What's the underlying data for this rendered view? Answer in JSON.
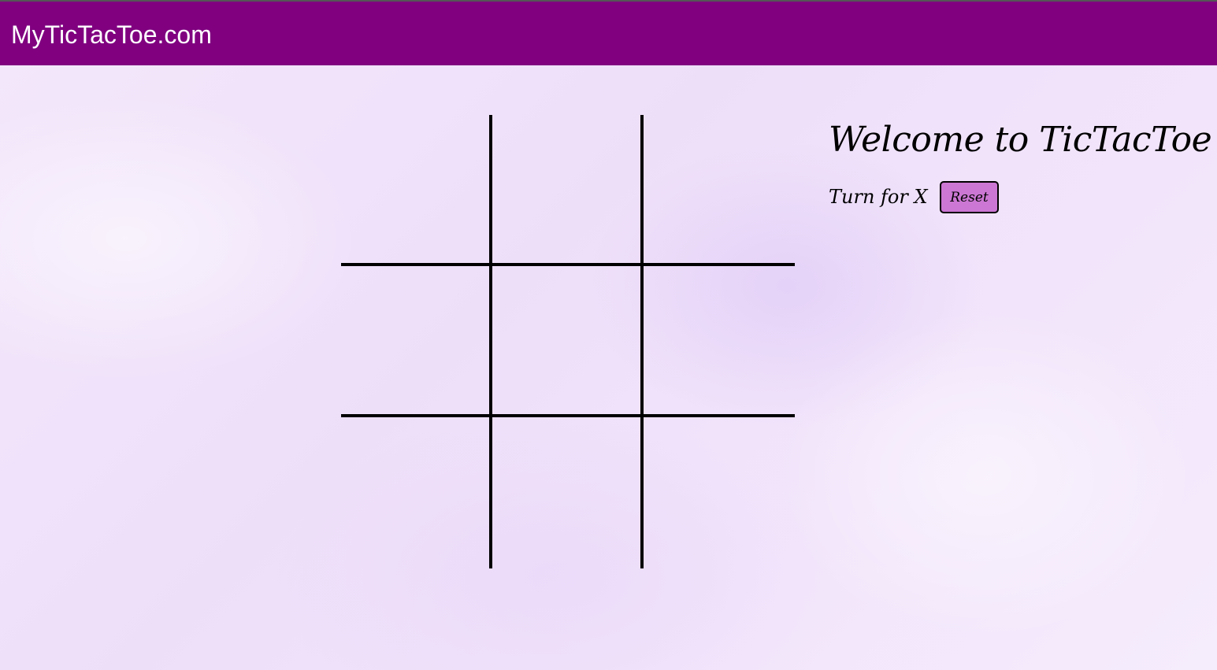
{
  "navbar": {
    "brand": "MyTicTacToe.com"
  },
  "board": {
    "cells": [
      "",
      "",
      "",
      "",
      "",
      "",
      "",
      "",
      ""
    ]
  },
  "panel": {
    "title": "Welcome to TicTacToe",
    "turn_text": "Turn for X",
    "reset_label": "Reset"
  },
  "colors": {
    "navbar": "#800080",
    "background": "#f1e4fb",
    "reset_button": "#cc77d4",
    "grid_lines": "#000000"
  }
}
